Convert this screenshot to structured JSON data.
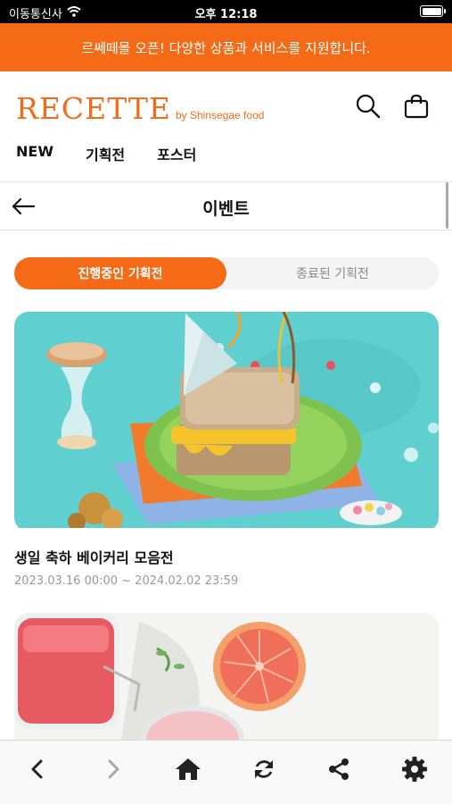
{
  "status_bar": {
    "carrier": "이동통신사",
    "time": "오후 12:18"
  },
  "banner": {
    "text": "르쎄떼몰 오픈! 다양한 상품과 서비스를 지원합니다."
  },
  "header": {
    "logo_main": "RECETTE",
    "logo_sub": "by Shinsegae food",
    "icons": [
      "search-icon",
      "shopping-bag-icon"
    ],
    "nav": [
      {
        "label": "NEW"
      },
      {
        "label": "기획전"
      },
      {
        "label": "포스터"
      }
    ]
  },
  "page": {
    "title": "이벤트"
  },
  "tabs": [
    {
      "label": "진행중인 기획전",
      "active": true
    },
    {
      "label": "종료된 기획전",
      "active": false
    }
  ],
  "events": [
    {
      "title": "생일 축하 베이커리 모음전",
      "date": "2023.03.16 00:00 ~ 2024.02.02 23:59"
    }
  ],
  "bottom_bar": {
    "icons": [
      "back-arrow-icon",
      "forward-arrow-icon",
      "home-icon",
      "refresh-icon",
      "share-icon",
      "settings-icon"
    ]
  },
  "colors": {
    "accent": "#f46a16",
    "image1_bg": "#5fd0cf",
    "image2_bg": "#efefec"
  }
}
